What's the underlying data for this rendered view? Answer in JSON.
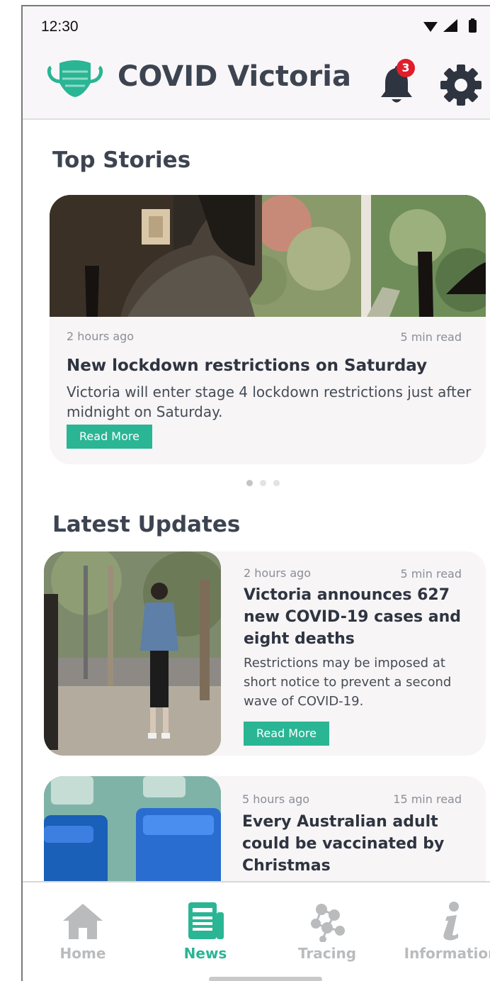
{
  "status_bar": {
    "time": "12:30"
  },
  "header": {
    "title": "COVID Victoria",
    "notification_count": "3"
  },
  "top_stories": {
    "section_title": "Top Stories",
    "card": {
      "time_ago": "2 hours ago",
      "read_time": "5 min read",
      "headline": "New lockdown restrictions on Saturday",
      "summary": "Victoria will enter stage 4 lockdown restrictions just after midnight on Saturday.",
      "button_label": "Read More"
    },
    "carousel_page": 1,
    "carousel_count": 3
  },
  "latest_updates": {
    "section_title": "Latest Updates",
    "items": [
      {
        "time_ago": "2 hours ago",
        "read_time": "5 min read",
        "headline": "Victoria announces 627 new COVID-19 cases and eight deaths",
        "summary": "Restrictions may be imposed at short notice to prevent a second wave of COVID-19.",
        "button_label": "Read More"
      },
      {
        "time_ago": "5 hours ago",
        "read_time": "15 min read",
        "headline": "Every Australian adult could be vaccinated by Christmas"
      }
    ]
  },
  "bottom_nav": {
    "items": [
      {
        "label": "Home",
        "icon": "home-icon"
      },
      {
        "label": "News",
        "icon": "news-icon",
        "active": true
      },
      {
        "label": "Tracing",
        "icon": "tracing-icon"
      },
      {
        "label": "Information",
        "icon": "information-icon"
      }
    ]
  },
  "colors": {
    "accent": "#2ab594",
    "title": "#3d4451",
    "badge": "#e01e2b",
    "card_bg": "#f7f5f6"
  }
}
